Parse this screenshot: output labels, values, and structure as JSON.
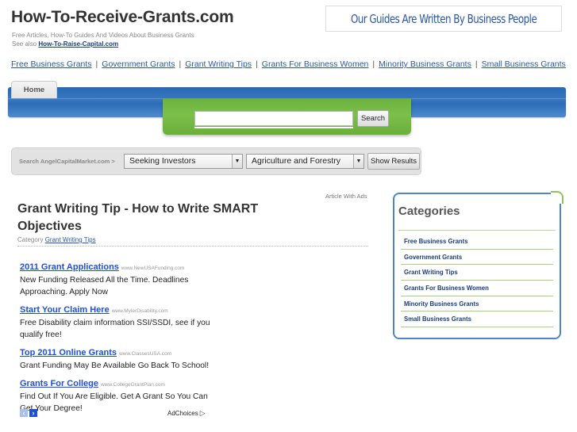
{
  "header": {
    "site_title": "How-To-Receive-Grants.com",
    "tagline": "Free Articles, How-To Guides And Videos About Business Grants",
    "see_also_prefix": "See also",
    "see_also_link": "How-To-Raise-Capital.com",
    "banner_text": "Our Guides Are Written By Business People"
  },
  "topnav": {
    "separator": "|",
    "items": [
      {
        "label": "Free Business Grants"
      },
      {
        "label": "Government Grants"
      },
      {
        "label": "Grant Writing Tips"
      },
      {
        "label": "Grants For Business Women"
      },
      {
        "label": "Minority Business Grants"
      },
      {
        "label": "Small Business Grants"
      }
    ]
  },
  "navbar": {
    "home_tab": "Home",
    "search_value": "",
    "search_button": "Search"
  },
  "acm_search": {
    "label": "Search AngelCapitalMarket.com >",
    "select1_value": "Seeking Investors",
    "select2_value": "Agriculture and Forestry",
    "show_button": "Show Results",
    "arrow": "▼"
  },
  "article": {
    "ads_label": "Article With Ads",
    "title": "Grant Writing Tip - How to Write SMART Objectives",
    "category_prefix": "Category",
    "category_link": "Grant Writing Tips"
  },
  "ads": {
    "items": [
      {
        "title": "2011 Grant Applications",
        "url": "www.NewUSAFunding.com",
        "desc": "New Funding Released All the Time. Deadlines Approaching. Apply Now"
      },
      {
        "title": "Start Your Claim Here",
        "url": "www.MylerDisability.com",
        "desc": "Free Disability claim information SSI/SSDI, see if you qualify free!"
      },
      {
        "title": "Top 2011 Online Grants",
        "url": "www.ClassesUSA.com",
        "desc": "Grant Funding May Be Available Go Back To School!"
      },
      {
        "title": "Grants For College",
        "url": "www.CollegeGrantPlan.com",
        "desc": "Find Out If You Are Eligible. Get A Grant So You Can Get Your Degree!"
      }
    ],
    "prev_icon": "‹",
    "next_icon": "›",
    "adchoices_label": "AdChoices",
    "adchoices_icon": "▷"
  },
  "sidebar": {
    "title": "Categories",
    "items": [
      {
        "label": "Free Business Grants"
      },
      {
        "label": "Government Grants"
      },
      {
        "label": "Grant Writing Tips"
      },
      {
        "label": "Grants For Business Women"
      },
      {
        "label": "Minority Business Grants"
      },
      {
        "label": "Small Business Grants"
      }
    ]
  },
  "colors": {
    "link_blue": "#2a56a8",
    "ad_blue": "#1f4fd8",
    "nav_blue": "#2d6db8",
    "search_green": "#7cc04a",
    "sidebar_border": "#4f86c4",
    "sidebar_divider_green": "#a8d27e"
  }
}
